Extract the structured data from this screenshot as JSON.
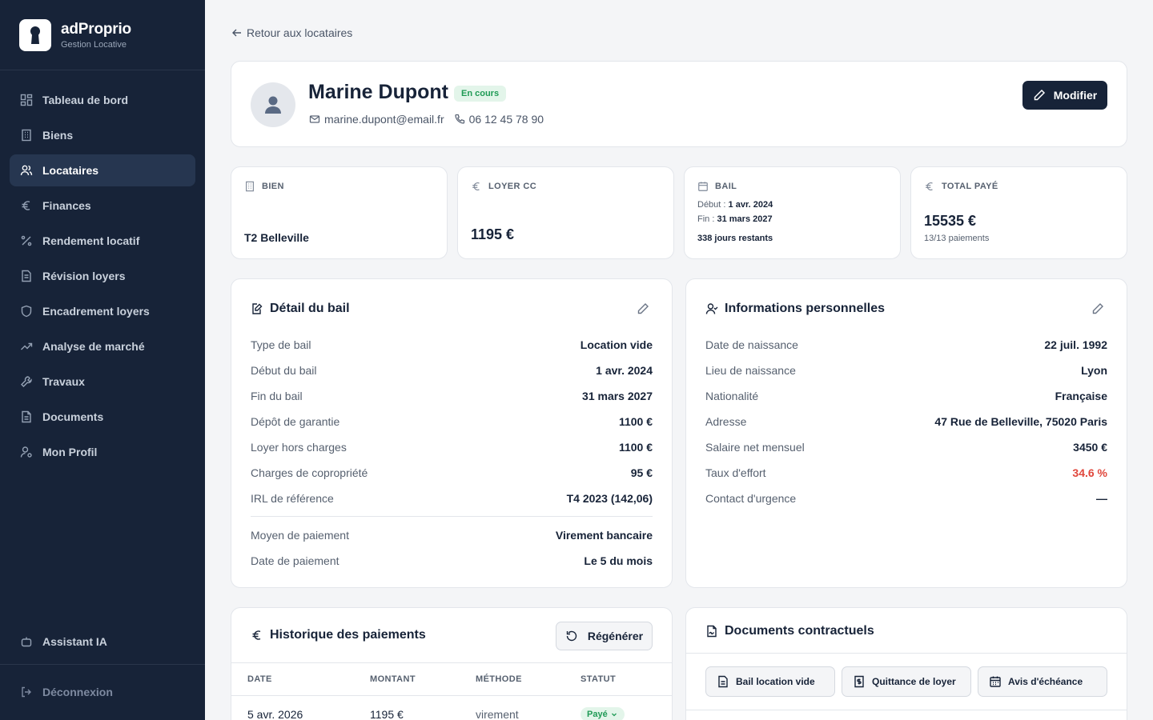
{
  "brand": {
    "name": "adProprio",
    "subtitle": "Gestion Locative"
  },
  "nav": {
    "items": [
      {
        "label": "Tableau de bord",
        "icon": "dashboard-icon"
      },
      {
        "label": "Biens",
        "icon": "building-icon"
      },
      {
        "label": "Locataires",
        "icon": "users-icon",
        "active": true
      },
      {
        "label": "Finances",
        "icon": "euro-icon"
      },
      {
        "label": "Rendement locatif",
        "icon": "percent-icon"
      },
      {
        "label": "Révision loyers",
        "icon": "document-icon"
      },
      {
        "label": "Encadrement loyers",
        "icon": "shield-icon"
      },
      {
        "label": "Analyse de marché",
        "icon": "trending-up-icon"
      },
      {
        "label": "Travaux",
        "icon": "wrench-icon"
      },
      {
        "label": "Documents",
        "icon": "file-icon"
      },
      {
        "label": "Mon Profil",
        "icon": "user-cog-icon"
      }
    ],
    "assistant": "Assistant IA",
    "logout": "Déconnexion"
  },
  "back_label": "Retour aux locataires",
  "tenant": {
    "name": "Marine Dupont",
    "status": "En cours",
    "email": "marine.dupont@email.fr",
    "phone": "06 12 45 78 90",
    "edit_label": "Modifier"
  },
  "stats": {
    "bien": {
      "label": "BIEN",
      "value": "T2 Belleville"
    },
    "loyer": {
      "label": "LOYER CC",
      "value": "1195 €"
    },
    "bail": {
      "label": "BAIL",
      "start_label": "Début :",
      "start": "1 avr. 2024",
      "end_label": "Fin :",
      "end": "31 mars 2027",
      "remaining": "338 jours restants"
    },
    "total": {
      "label": "TOTAL PAYÉ",
      "value": "15535 €",
      "sub": "13/13 paiements"
    }
  },
  "lease": {
    "title": "Détail du bail",
    "rows": [
      {
        "k": "Type de bail",
        "v": "Location vide"
      },
      {
        "k": "Début du bail",
        "v": "1 avr. 2024"
      },
      {
        "k": "Fin du bail",
        "v": "31 mars 2027"
      },
      {
        "k": "Dépôt de garantie",
        "v": "1100 €"
      },
      {
        "k": "Loyer hors charges",
        "v": "1100 €"
      },
      {
        "k": "Charges de copropriété",
        "v": "95 €"
      },
      {
        "k": "IRL de référence",
        "v": "T4 2023 (142,06)"
      }
    ],
    "payment_rows": [
      {
        "k": "Moyen de paiement",
        "v": "Virement bancaire"
      },
      {
        "k": "Date de paiement",
        "v": "Le 5 du mois"
      }
    ]
  },
  "personal": {
    "title": "Informations personnelles",
    "rows": [
      {
        "k": "Date de naissance",
        "v": "22 juil. 1992"
      },
      {
        "k": "Lieu de naissance",
        "v": "Lyon"
      },
      {
        "k": "Nationalité",
        "v": "Française"
      },
      {
        "k": "Adresse",
        "v": "47 Rue de Belleville, 75020 Paris"
      },
      {
        "k": "Salaire net mensuel",
        "v": "3450 €"
      },
      {
        "k": "Taux d'effort",
        "v": "34.6 %",
        "color": "#e0473c"
      },
      {
        "k": "Contact d'urgence",
        "v": "—"
      }
    ]
  },
  "payments": {
    "title": "Historique des paiements",
    "regen_label": "Régénérer",
    "columns": [
      "DATE",
      "MONTANT",
      "MÉTHODE",
      "STATUT"
    ],
    "rows": [
      {
        "date": "5 avr. 2026",
        "amount": "1195 €",
        "method": "virement",
        "status": "Payé"
      }
    ]
  },
  "documents": {
    "title": "Documents contractuels",
    "buttons": [
      "Bail location vide",
      "Quittance de loyer",
      "Avis d'échéance"
    ]
  },
  "colors": {
    "sidebar": "#172338",
    "active_nav": "#263650",
    "success": "#1f9a55",
    "danger": "#e0473c"
  }
}
